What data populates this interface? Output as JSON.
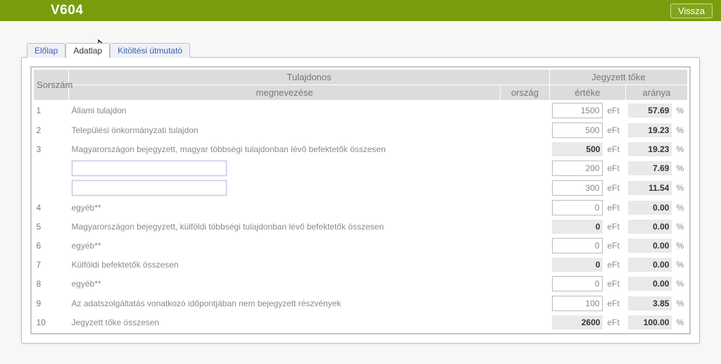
{
  "header": {
    "title": "V604",
    "back_label": "Vissza"
  },
  "tabs": [
    {
      "id": "elolap",
      "label": "Előlap",
      "active": false
    },
    {
      "id": "adatlap",
      "label": "Adatlap",
      "active": true
    },
    {
      "id": "utmutato",
      "label": "Kitöltési útmutató",
      "active": false
    }
  ],
  "table": {
    "headers": {
      "index": "Sorszám",
      "owner": "Tulajdonos",
      "name": "megnevezése",
      "country": "ország",
      "capital": "Jegyzett tőke",
      "value": "értéke",
      "ratio": "aránya"
    },
    "unit_label": "eFt",
    "pct_label": "%",
    "rows": [
      {
        "idx": "1",
        "desc": "Állami tulajdon",
        "value": "1500",
        "ratio": "57.69",
        "editable_value": true
      },
      {
        "idx": "2",
        "desc": "Települési önkormányzati tulajdon",
        "value": "500",
        "ratio": "19.23",
        "editable_value": true
      },
      {
        "idx": "3",
        "desc": "Magyarországon bejegyzett, magyar többségi tulajdonban lévő befektetők összesen",
        "value": "500",
        "ratio": "19.23",
        "editable_value": false
      },
      {
        "idx": "",
        "desc": "",
        "name_input": " ",
        "value": "200",
        "ratio": "7.69",
        "editable_value": true
      },
      {
        "idx": "",
        "desc": "",
        "name_input": " ",
        "value": "300",
        "ratio": "11.54",
        "editable_value": true
      },
      {
        "idx": "4",
        "desc": "egyéb**",
        "value": "0",
        "ratio": "0.00",
        "editable_value": true
      },
      {
        "idx": "5",
        "desc": "Magyarországon bejegyzett, külföldi többségi tulajdonban lévő befektetők összesen",
        "value": "0",
        "ratio": "0.00",
        "editable_value": false
      },
      {
        "idx": "6",
        "desc": "egyéb**",
        "value": "0",
        "ratio": "0.00",
        "editable_value": true
      },
      {
        "idx": "7",
        "desc": "Külföldi befektetők összesen",
        "value": "0",
        "ratio": "0.00",
        "editable_value": false
      },
      {
        "idx": "8",
        "desc": "egyéb**",
        "value": "0",
        "ratio": "0.00",
        "editable_value": true
      },
      {
        "idx": "9",
        "desc": "Az adatszolgáltatás vonatkozó időpontjában nem bejegyzett részvények",
        "value": "100",
        "ratio": "3.85",
        "editable_value": true
      },
      {
        "idx": "10",
        "desc": "Jegyzett tőke összesen",
        "value": "2600",
        "ratio": "100.00",
        "editable_value": false
      }
    ]
  }
}
